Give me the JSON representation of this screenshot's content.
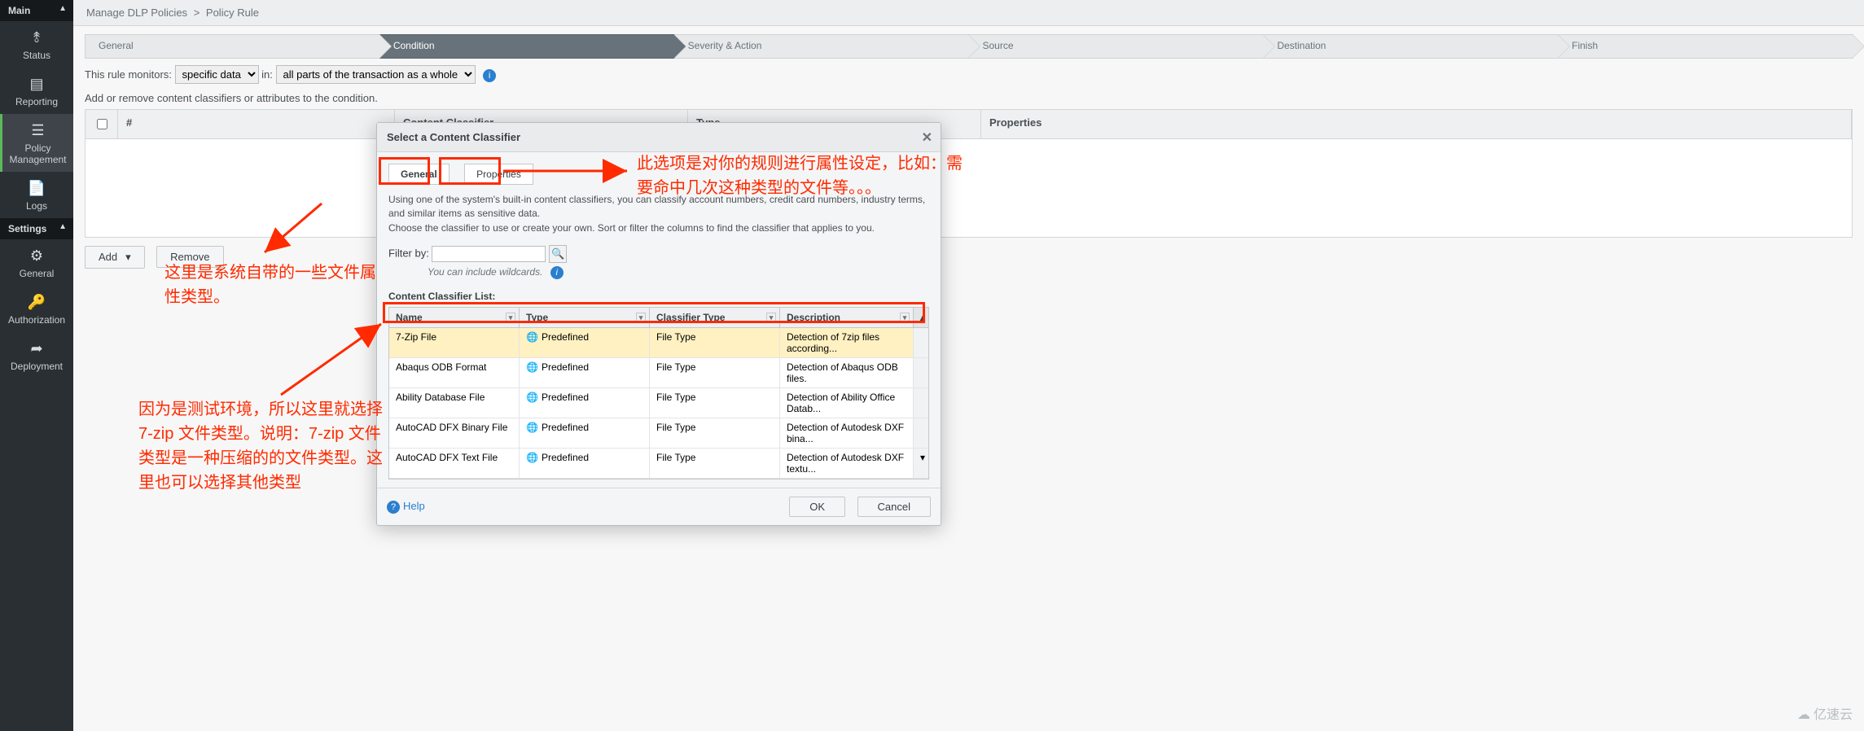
{
  "sidebar": {
    "main_label": "Main",
    "settings_label": "Settings",
    "items": [
      {
        "label": "Status",
        "icon": "pulse-icon"
      },
      {
        "label": "Reporting",
        "icon": "bar-chart-icon"
      },
      {
        "label": "Policy Management",
        "icon": "list-icon"
      },
      {
        "label": "Logs",
        "icon": "doc-icon"
      }
    ],
    "settings_items": [
      {
        "label": "General",
        "icon": "gear-icon"
      },
      {
        "label": "Authorization",
        "icon": "key-icon"
      },
      {
        "label": "Deployment",
        "icon": "share-icon"
      }
    ]
  },
  "breadcrumb": {
    "a": "Manage DLP Policies",
    "sep": ">",
    "b": "Policy Rule"
  },
  "wizard": {
    "steps": [
      "General",
      "Condition",
      "Severity & Action",
      "Source",
      "Destination",
      "Finish"
    ],
    "active": 1
  },
  "monitors": {
    "label": "This rule monitors:",
    "opt1": "specific data",
    "in": "in:",
    "opt2": "all parts of the transaction as a whole"
  },
  "instr": "Add or remove content classifiers or attributes to the condition.",
  "grid": {
    "cols": [
      "#",
      "Content Classifier",
      "Type",
      "Properties"
    ]
  },
  "actions": {
    "add": "Add",
    "remove": "Remove"
  },
  "dialog": {
    "title": "Select a Content Classifier",
    "tabs": {
      "general": "General",
      "properties": "Properties"
    },
    "desc1": "Using one of the system's built-in content classifiers, you can classify account numbers, credit card numbers, industry terms, and similar items as sensitive data.",
    "desc2": "Choose the classifier to use or create your own. Sort or filter the columns to find the classifier that applies to you.",
    "filter_label": "Filter by:",
    "wildcards": "You can include wildcards.",
    "ccl_label": "Content Classifier List:",
    "cols": {
      "name": "Name",
      "type": "Type",
      "ctype": "Classifier Type",
      "desc": "Description"
    },
    "rows": [
      {
        "name": "7-Zip File",
        "type": "Predefined",
        "ctype": "File Type",
        "desc": "Detection of 7zip files according..."
      },
      {
        "name": "Abaqus ODB Format",
        "type": "Predefined",
        "ctype": "File Type",
        "desc": "Detection of Abaqus ODB files."
      },
      {
        "name": "Ability Database File",
        "type": "Predefined",
        "ctype": "File Type",
        "desc": "Detection of Ability Office Datab..."
      },
      {
        "name": "AutoCAD DFX Binary File",
        "type": "Predefined",
        "ctype": "File Type",
        "desc": "Detection of Autodesk DXF bina..."
      },
      {
        "name": "AutoCAD DFX Text File",
        "type": "Predefined",
        "ctype": "File Type",
        "desc": "Detection of Autodesk DXF textu..."
      }
    ],
    "help": "Help",
    "ok": "OK",
    "cancel": "Cancel"
  },
  "annotations": {
    "a1": "这里是系统自带的一些文件属性类型。",
    "a2": "此选项是对你的规则进行属性设定，比如：需要命中几次这种类型的文件等。。。",
    "a3": "因为是测试环境，所以这里就选择7-zip 文件类型。说明：7-zip 文件类型是一种压缩的的文件类型。这里也可以选择其他类型"
  },
  "watermark": "亿速云"
}
